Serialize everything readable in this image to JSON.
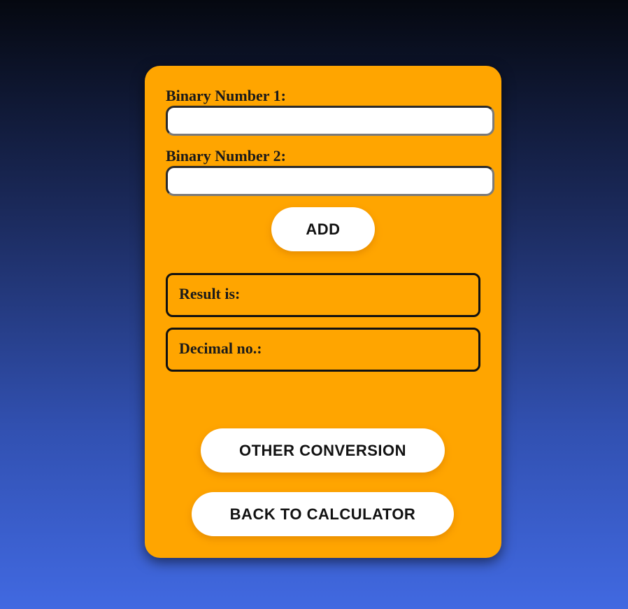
{
  "form": {
    "binary1_label": "Binary Number 1:",
    "binary1_value": "",
    "binary2_label": "Binary Number 2:",
    "binary2_value": "",
    "add_button": "ADD"
  },
  "results": {
    "result_label": "Result is:",
    "decimal_label": "Decimal no.:"
  },
  "actions": {
    "other_conversion": "OTHER CONVERSION",
    "back_to_calculator": "BACK TO CALCULATOR"
  },
  "colors": {
    "card": "#ffa500",
    "background_top": "#050810",
    "background_bottom": "#4169e1"
  }
}
